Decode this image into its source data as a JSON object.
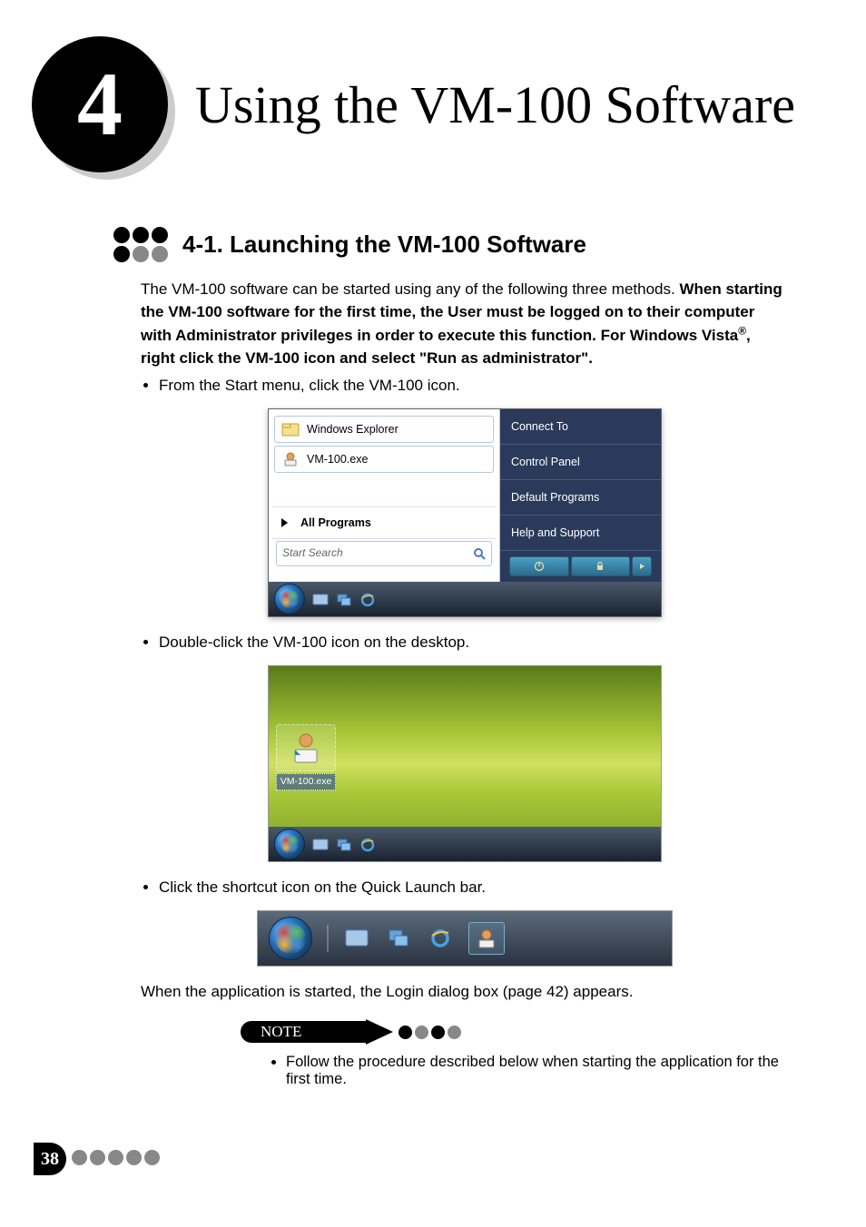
{
  "chapter": {
    "number": "4",
    "title": "Using the VM-100 Software"
  },
  "section": {
    "number_title": "4-1.  Launching the VM-100 Software"
  },
  "paragraphs": {
    "intro": "The VM-100 software can be started using any of the following three methods.",
    "bold1": "When starting the VM-100 software for the first time, the User must be logged on to their computer with Administrator privileges in order to execute this function. For Windows Vista",
    "reg": "®",
    "bold2": ", right click the VM-100 icon and select \"Run as administrator\".",
    "bullet1": "From the Start menu, click the VM-100 icon.",
    "bullet2": "Double-click the VM-100 icon on the desktop.",
    "bullet3": "Click the shortcut icon on the Quick Launch bar.",
    "after": "When the application is started, the Login dialog box (page 42) appears."
  },
  "startmenu": {
    "item1": "Windows Explorer",
    "item2": "VM-100.exe",
    "allprograms": "All Programs",
    "search": "Start Search",
    "right": [
      "Connect To",
      "Control Panel",
      "Default Programs",
      "Help and Support"
    ]
  },
  "desktop": {
    "icon_label": "VM-100.exe"
  },
  "note": {
    "label": "NOTE",
    "text": "Follow the procedure described below when starting the application for the first time."
  },
  "page_number": "38"
}
